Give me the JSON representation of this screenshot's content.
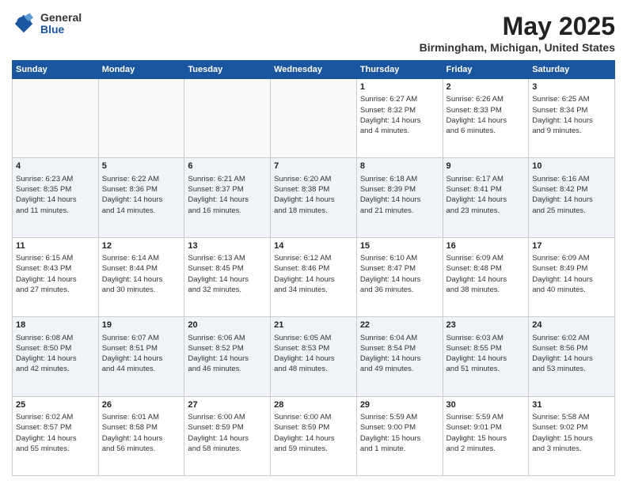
{
  "logo": {
    "general": "General",
    "blue": "Blue"
  },
  "header": {
    "title": "May 2025",
    "subtitle": "Birmingham, Michigan, United States"
  },
  "days_of_week": [
    "Sunday",
    "Monday",
    "Tuesday",
    "Wednesday",
    "Thursday",
    "Friday",
    "Saturday"
  ],
  "weeks": [
    [
      {
        "day": "",
        "content": ""
      },
      {
        "day": "",
        "content": ""
      },
      {
        "day": "",
        "content": ""
      },
      {
        "day": "",
        "content": ""
      },
      {
        "day": "1",
        "content": "Sunrise: 6:27 AM\nSunset: 8:32 PM\nDaylight: 14 hours\nand 4 minutes."
      },
      {
        "day": "2",
        "content": "Sunrise: 6:26 AM\nSunset: 8:33 PM\nDaylight: 14 hours\nand 6 minutes."
      },
      {
        "day": "3",
        "content": "Sunrise: 6:25 AM\nSunset: 8:34 PM\nDaylight: 14 hours\nand 9 minutes."
      }
    ],
    [
      {
        "day": "4",
        "content": "Sunrise: 6:23 AM\nSunset: 8:35 PM\nDaylight: 14 hours\nand 11 minutes."
      },
      {
        "day": "5",
        "content": "Sunrise: 6:22 AM\nSunset: 8:36 PM\nDaylight: 14 hours\nand 14 minutes."
      },
      {
        "day": "6",
        "content": "Sunrise: 6:21 AM\nSunset: 8:37 PM\nDaylight: 14 hours\nand 16 minutes."
      },
      {
        "day": "7",
        "content": "Sunrise: 6:20 AM\nSunset: 8:38 PM\nDaylight: 14 hours\nand 18 minutes."
      },
      {
        "day": "8",
        "content": "Sunrise: 6:18 AM\nSunset: 8:39 PM\nDaylight: 14 hours\nand 21 minutes."
      },
      {
        "day": "9",
        "content": "Sunrise: 6:17 AM\nSunset: 8:41 PM\nDaylight: 14 hours\nand 23 minutes."
      },
      {
        "day": "10",
        "content": "Sunrise: 6:16 AM\nSunset: 8:42 PM\nDaylight: 14 hours\nand 25 minutes."
      }
    ],
    [
      {
        "day": "11",
        "content": "Sunrise: 6:15 AM\nSunset: 8:43 PM\nDaylight: 14 hours\nand 27 minutes."
      },
      {
        "day": "12",
        "content": "Sunrise: 6:14 AM\nSunset: 8:44 PM\nDaylight: 14 hours\nand 30 minutes."
      },
      {
        "day": "13",
        "content": "Sunrise: 6:13 AM\nSunset: 8:45 PM\nDaylight: 14 hours\nand 32 minutes."
      },
      {
        "day": "14",
        "content": "Sunrise: 6:12 AM\nSunset: 8:46 PM\nDaylight: 14 hours\nand 34 minutes."
      },
      {
        "day": "15",
        "content": "Sunrise: 6:10 AM\nSunset: 8:47 PM\nDaylight: 14 hours\nand 36 minutes."
      },
      {
        "day": "16",
        "content": "Sunrise: 6:09 AM\nSunset: 8:48 PM\nDaylight: 14 hours\nand 38 minutes."
      },
      {
        "day": "17",
        "content": "Sunrise: 6:09 AM\nSunset: 8:49 PM\nDaylight: 14 hours\nand 40 minutes."
      }
    ],
    [
      {
        "day": "18",
        "content": "Sunrise: 6:08 AM\nSunset: 8:50 PM\nDaylight: 14 hours\nand 42 minutes."
      },
      {
        "day": "19",
        "content": "Sunrise: 6:07 AM\nSunset: 8:51 PM\nDaylight: 14 hours\nand 44 minutes."
      },
      {
        "day": "20",
        "content": "Sunrise: 6:06 AM\nSunset: 8:52 PM\nDaylight: 14 hours\nand 46 minutes."
      },
      {
        "day": "21",
        "content": "Sunrise: 6:05 AM\nSunset: 8:53 PM\nDaylight: 14 hours\nand 48 minutes."
      },
      {
        "day": "22",
        "content": "Sunrise: 6:04 AM\nSunset: 8:54 PM\nDaylight: 14 hours\nand 49 minutes."
      },
      {
        "day": "23",
        "content": "Sunrise: 6:03 AM\nSunset: 8:55 PM\nDaylight: 14 hours\nand 51 minutes."
      },
      {
        "day": "24",
        "content": "Sunrise: 6:02 AM\nSunset: 8:56 PM\nDaylight: 14 hours\nand 53 minutes."
      }
    ],
    [
      {
        "day": "25",
        "content": "Sunrise: 6:02 AM\nSunset: 8:57 PM\nDaylight: 14 hours\nand 55 minutes."
      },
      {
        "day": "26",
        "content": "Sunrise: 6:01 AM\nSunset: 8:58 PM\nDaylight: 14 hours\nand 56 minutes."
      },
      {
        "day": "27",
        "content": "Sunrise: 6:00 AM\nSunset: 8:59 PM\nDaylight: 14 hours\nand 58 minutes."
      },
      {
        "day": "28",
        "content": "Sunrise: 6:00 AM\nSunset: 8:59 PM\nDaylight: 14 hours\nand 59 minutes."
      },
      {
        "day": "29",
        "content": "Sunrise: 5:59 AM\nSunset: 9:00 PM\nDaylight: 15 hours\nand 1 minute."
      },
      {
        "day": "30",
        "content": "Sunrise: 5:59 AM\nSunset: 9:01 PM\nDaylight: 15 hours\nand 2 minutes."
      },
      {
        "day": "31",
        "content": "Sunrise: 5:58 AM\nSunset: 9:02 PM\nDaylight: 15 hours\nand 3 minutes."
      }
    ]
  ]
}
